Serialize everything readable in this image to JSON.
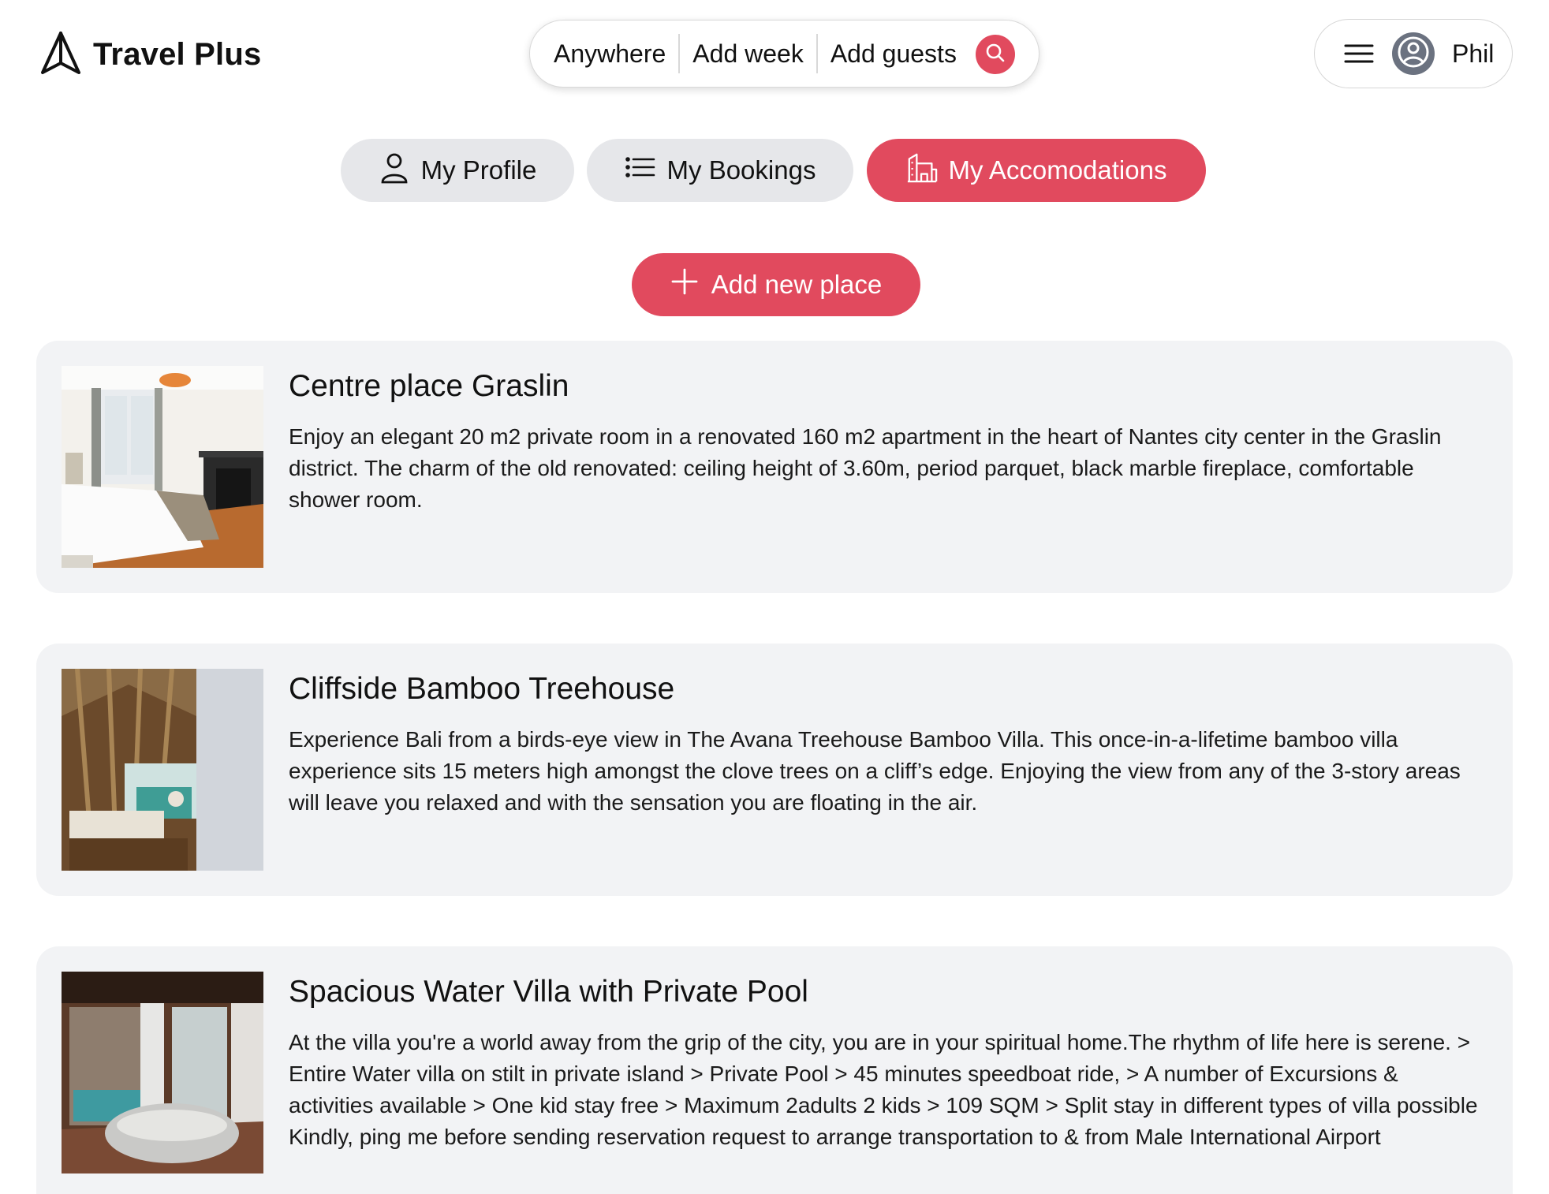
{
  "brand": {
    "name": "Travel Plus",
    "icon": "paper-plane-icon"
  },
  "search": {
    "where": "Anywhere",
    "when": "Add week",
    "who": "Add guests",
    "icon": "search-icon",
    "accent": "#e14a5e"
  },
  "user": {
    "name": "Phil",
    "menu_icon": "hamburger-icon",
    "avatar_icon": "user-circle-icon"
  },
  "tabs": [
    {
      "label": "My Profile",
      "icon": "user-icon",
      "active": false
    },
    {
      "label": "My Bookings",
      "icon": "list-icon",
      "active": false
    },
    {
      "label": "My Accomodations",
      "icon": "building-icon",
      "active": true
    }
  ],
  "actions": {
    "add_place_label": "Add new place",
    "add_icon": "plus-icon"
  },
  "places": [
    {
      "title": "Centre place Graslin",
      "description": "Enjoy an elegant 20 m2 private room in a renovated 160 m2 apartment in the heart of Nantes city center in the Graslin district. The charm of the old renovated: ceiling height of 3.60m, period parquet, black marble fireplace, comfortable shower room."
    },
    {
      "title": "Cliffside Bamboo Treehouse",
      "description": "Experience Bali from a birds-eye view in The Avana Treehouse Bamboo Villa. This once-in-a-lifetime bamboo villa experience sits 15 meters high amongst the clove trees on a cliff’s edge. Enjoying the view from any of the 3-story areas will leave you relaxed and with the sensation you are floating in the air."
    },
    {
      "title": "Spacious Water Villa with Private Pool",
      "description": "At the villa you're a world away from the grip of the city, you are in your spiritual home.The rhythm of life here is serene. > Entire Water villa on stilt in private island > Private Pool > 45 minutes speedboat ride, > A number of Excursions & activities available > One kid stay free > Maximum 2adults 2 kids > 109 SQM > Split stay in different types of villa possible Kindly, ping me before sending reservation request to arrange transportation to & from Male International Airport"
    }
  ]
}
